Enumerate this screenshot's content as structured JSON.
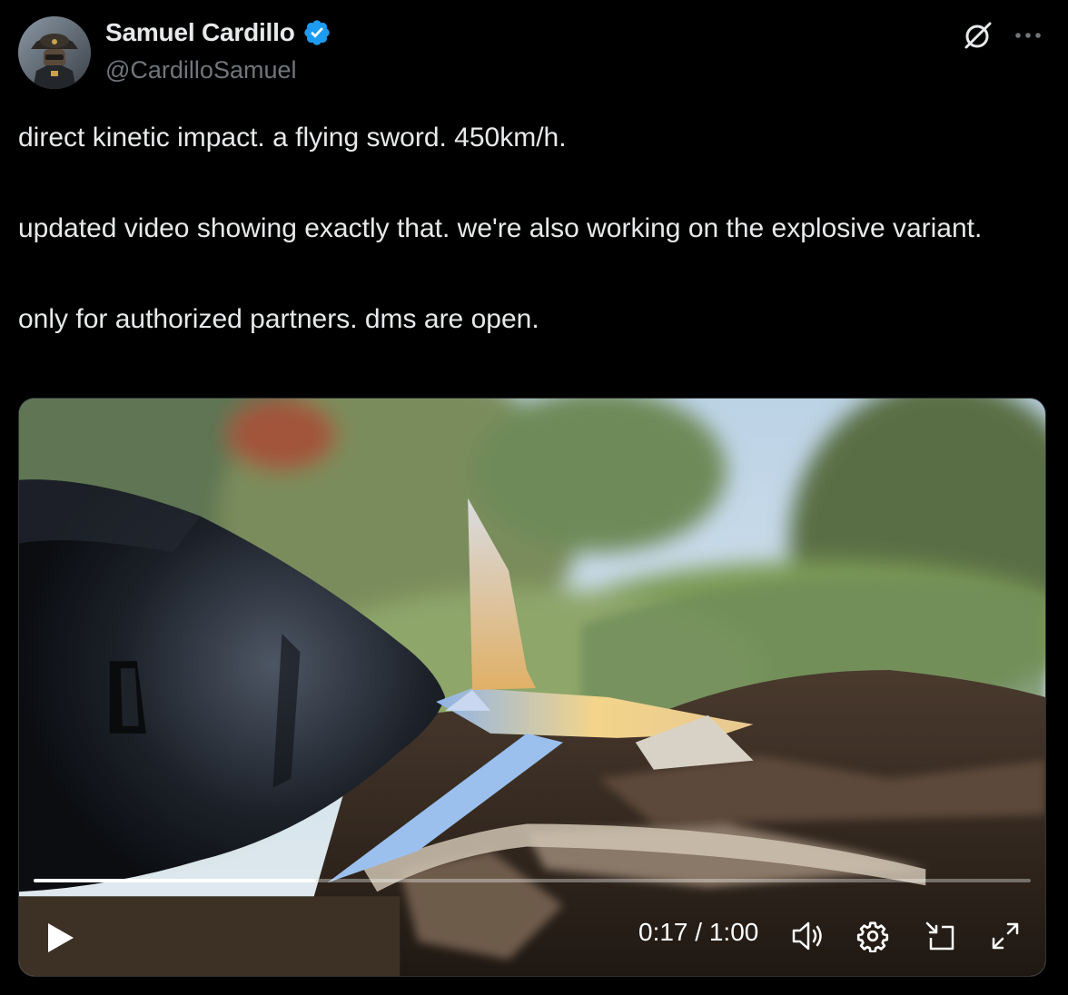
{
  "author": {
    "display_name": "Samuel Cardillo",
    "handle": "@CardilloSamuel",
    "verified": true
  },
  "icons": {
    "verified": "verified-badge-icon",
    "grok": "grok-icon",
    "more": "more-icon",
    "play": "play-icon",
    "volume": "volume-icon",
    "settings": "gear-icon",
    "minimize": "minimize-icon",
    "fullscreen": "fullscreen-icon"
  },
  "tweet": {
    "paragraphs": [
      "direct kinetic impact. a flying sword. 450km/h.",
      "updated video showing exactly that. we're also working on the explosive variant.",
      "only for authorized partners. dms are open."
    ]
  },
  "video": {
    "current_time": "0:17",
    "separator": "/",
    "duration": "1:00",
    "progress_fraction": 0.283
  },
  "colors": {
    "background": "#000000",
    "text": "#e7e9ea",
    "secondary_text": "#71767b",
    "verified_blue": "#1d9bf0"
  }
}
